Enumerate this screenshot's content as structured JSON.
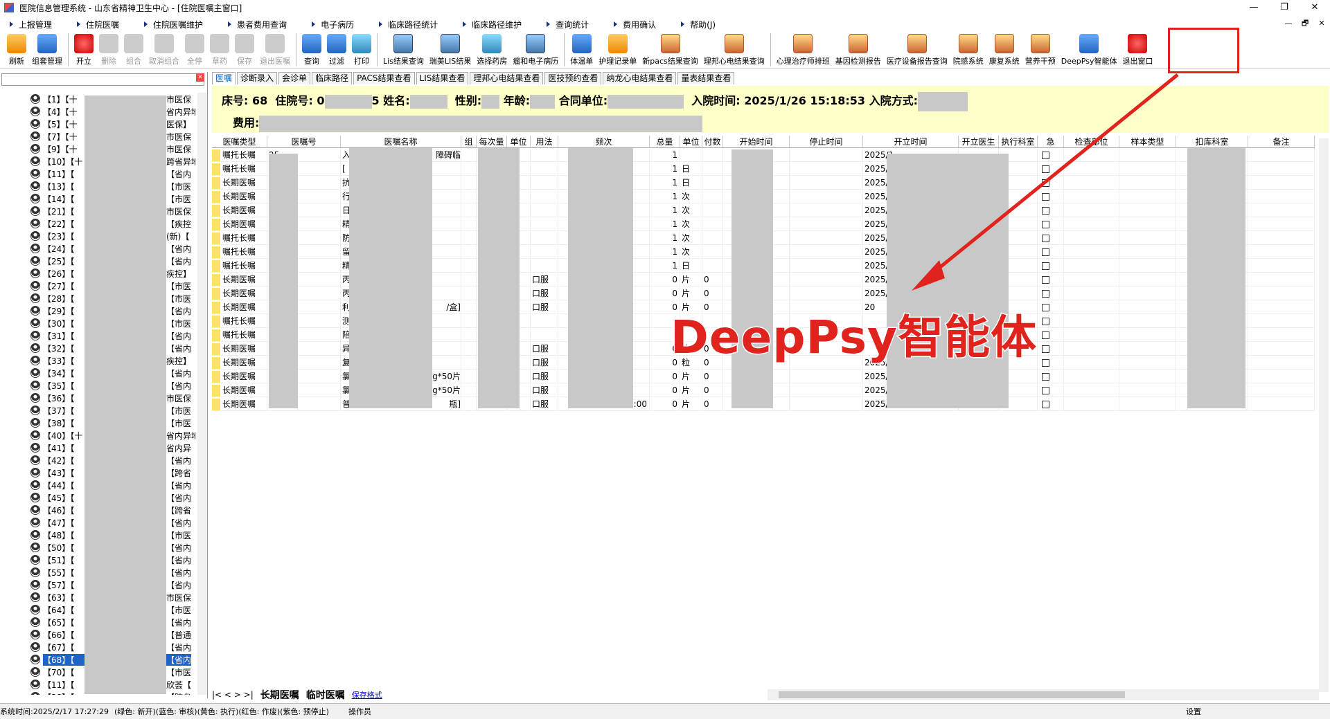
{
  "window": {
    "title": "医院信息管理系统 - 山东省精神卫生中心 - [住院医嘱主窗口]",
    "controls": [
      "—",
      "❐",
      "✕"
    ]
  },
  "menu": {
    "items": [
      "上报管理",
      "住院医嘱",
      "住院医嘱维护",
      "患者费用查询",
      "电子病历",
      "临床路径统计",
      "临床路径维护",
      "查询统计",
      "费用确认",
      "帮助(J)"
    ],
    "right_controls": [
      "—",
      "🗗",
      "✕"
    ]
  },
  "toolbar": {
    "buttons": [
      {
        "label": "刷新",
        "icon": "refresh-icon"
      },
      {
        "label": "组套管理",
        "icon": "cubes-icon"
      },
      {
        "label": "开立",
        "icon": "new-order-icon"
      },
      {
        "label": "删除",
        "icon": "delete-icon"
      },
      {
        "label": "组合",
        "icon": "combine-icon"
      },
      {
        "label": "取消组合",
        "icon": "cancel-combine-icon"
      },
      {
        "label": "全停",
        "icon": "stop-all-icon"
      },
      {
        "label": "草药",
        "icon": "herb-icon"
      },
      {
        "label": "保存",
        "icon": "save-icon"
      },
      {
        "label": "退出医嘱",
        "icon": "exit-order-icon"
      },
      {
        "label": "查询",
        "icon": "search-icon"
      },
      {
        "label": "过滤",
        "icon": "filter-icon"
      },
      {
        "label": "打印",
        "icon": "print-icon"
      },
      {
        "label": "Lis结果查询",
        "icon": "lis-icon"
      },
      {
        "label": "瑞美LIS结果",
        "icon": "lis-icon"
      },
      {
        "label": "选择药房",
        "icon": "pharmacy-icon"
      },
      {
        "label": "瘤和电子病历",
        "icon": "emr-icon"
      },
      {
        "label": "体温单",
        "icon": "thermometer-icon"
      },
      {
        "label": "护理记录单",
        "icon": "nurse-icon"
      },
      {
        "label": "新pacs结果查询",
        "icon": "pacs-icon"
      },
      {
        "label": "理邦心电结果查询",
        "icon": "ecg-icon"
      },
      {
        "label": "心理治疗师排班",
        "icon": "schedule-icon"
      },
      {
        "label": "基因检测报告",
        "icon": "gene-icon"
      },
      {
        "label": "医疗设备报告查询",
        "icon": "device-icon"
      },
      {
        "label": "院感系统",
        "icon": "infection-icon"
      },
      {
        "label": "康复系统",
        "icon": "rehab-icon"
      },
      {
        "label": "营养干预",
        "icon": "nutrition-icon"
      },
      {
        "label": "DeepPsy智能体",
        "icon": "deeppsy-icon"
      },
      {
        "label": "退出窗口",
        "icon": "power-icon"
      }
    ]
  },
  "patient_tree": {
    "rows": [
      {
        "bed": "【1】【十",
        "ins": "市医保"
      },
      {
        "bed": "【4】【十",
        "ins": "省内异地"
      },
      {
        "bed": "【5】【十",
        "ins": "医保】"
      },
      {
        "bed": "【7】【十",
        "ins": "市医保"
      },
      {
        "bed": "【9】【十",
        "ins": "市医保"
      },
      {
        "bed": "【10】【十",
        "ins": "跨省异地"
      },
      {
        "bed": "【11】【",
        "ins": "【省内"
      },
      {
        "bed": "【13】【",
        "ins": "【市医"
      },
      {
        "bed": "【14】【",
        "ins": "【市医"
      },
      {
        "bed": "【21】【",
        "ins": "市医保"
      },
      {
        "bed": "【22】【",
        "ins": "【疾控"
      },
      {
        "bed": "【23】【",
        "ins": "(新)【"
      },
      {
        "bed": "【24】【",
        "ins": "【省内"
      },
      {
        "bed": "【25】【",
        "ins": "【省内"
      },
      {
        "bed": "【26】【",
        "ins": "疾控】"
      },
      {
        "bed": "【27】【",
        "ins": "【市医"
      },
      {
        "bed": "【28】【",
        "ins": "【市医"
      },
      {
        "bed": "【29】【",
        "ins": "【省内"
      },
      {
        "bed": "【30】【",
        "ins": "【市医"
      },
      {
        "bed": "【31】【",
        "ins": "【省内"
      },
      {
        "bed": "【32】【",
        "ins": "【省内"
      },
      {
        "bed": "【33】【",
        "ins": "疾控】"
      },
      {
        "bed": "【34】【",
        "ins": "【省内"
      },
      {
        "bed": "【35】【",
        "ins": "【省内"
      },
      {
        "bed": "【36】【",
        "ins": "市医保"
      },
      {
        "bed": "【37】【",
        "ins": "【市医"
      },
      {
        "bed": "【38】【",
        "ins": "【市医"
      },
      {
        "bed": "【40】【十",
        "ins": "省内异地"
      },
      {
        "bed": "【41】【",
        "ins": "省内异"
      },
      {
        "bed": "【42】【",
        "ins": "【省内"
      },
      {
        "bed": "【43】【",
        "ins": "【跨省"
      },
      {
        "bed": "【44】【",
        "ins": "【省内"
      },
      {
        "bed": "【45】【",
        "ins": "【省内"
      },
      {
        "bed": "【46】【",
        "ins": "【跨省"
      },
      {
        "bed": "【47】【",
        "ins": "【省内"
      },
      {
        "bed": "【48】【",
        "ins": "【市医"
      },
      {
        "bed": "【50】【",
        "ins": "【省内"
      },
      {
        "bed": "【51】【",
        "ins": "【省内"
      },
      {
        "bed": "【55】【",
        "ins": "【省内"
      },
      {
        "bed": "【57】【",
        "ins": "【省内"
      },
      {
        "bed": "【63】【",
        "ins": "市医保"
      },
      {
        "bed": "【64】【",
        "ins": "【市医"
      },
      {
        "bed": "【65】【",
        "ins": "【省内"
      },
      {
        "bed": "【66】【",
        "ins": "【普通"
      },
      {
        "bed": "【67】【",
        "ins": "【省内"
      },
      {
        "bed": "【68】【",
        "ins": "【省内",
        "selected": true
      },
      {
        "bed": "【70】【",
        "ins": "【市医"
      },
      {
        "bed": "【11】【",
        "ins": "欣荟【"
      },
      {
        "bed": "【38】【",
        "ins": "【跨省"
      }
    ]
  },
  "tabs": [
    "医嘱",
    "诊断录入",
    "会诊单",
    "临床路径",
    "PACS结果查看",
    "LIS结果查看",
    "理邦心电结果查看",
    "医技预约查看",
    "纳龙心电结果查看",
    "量表结果查看"
  ],
  "patient_info": {
    "bed_label": "床号:",
    "bed_value": "68",
    "admission_no_label": "住院号:",
    "admission_no_prefix": "0",
    "admission_no_suffix": "5",
    "name_label": "姓名:",
    "gender_label": "性别:",
    "age_label": "年龄:",
    "unit_label": "合同单位:",
    "admit_time_label": "入院时间:",
    "admit_time_value": "2025/1/26 15:18:53",
    "admit_method_label": "入院方式:",
    "fee_label": "费用:"
  },
  "grid": {
    "headers": [
      "医嘱类型",
      "医嘱号",
      "医嘱名称",
      "组",
      "每次量",
      "单位",
      "用法",
      "频次",
      "总量",
      "单位",
      "付数",
      "开始时间",
      "停止时间",
      "开立时间",
      "开立医生",
      "执行科室",
      "急",
      "检查部位",
      "样本类型",
      "扣库科室",
      "备注"
    ],
    "rows": [
      {
        "type": "嘱托长嘱",
        "no": "25",
        "name": "入",
        "name_tail": "障碍临",
        "qty": "",
        "unit": "",
        "usage": "",
        "freq_tail": "",
        "total": "1",
        "tunit": "",
        "pay": "",
        "open": "2025/1"
      },
      {
        "type": "嘱托长嘱",
        "no": "25",
        "name": "[",
        "name_tail": "",
        "qty": "",
        "unit": "",
        "usage": "",
        "freq_tail": "",
        "total": "1",
        "tunit": "日",
        "pay": "",
        "open": "2025/1"
      },
      {
        "type": "长期医嘱",
        "no": "25",
        "name": "抗",
        "name_tail": "",
        "qty": "",
        "unit": "",
        "usage": "",
        "freq_tail": "",
        "total": "1",
        "tunit": "日",
        "pay": "",
        "open": "2025/1"
      },
      {
        "type": "长期医嘱",
        "no": "25",
        "name": "行",
        "name_tail": "",
        "qty": "",
        "unit": "",
        "usage": "",
        "freq_tail": "",
        "total": "1",
        "tunit": "次",
        "pay": "",
        "open": "2025/1"
      },
      {
        "type": "长期医嘱",
        "no": "25",
        "name": "日",
        "name_tail": "",
        "qty": "",
        "unit": "",
        "usage": "",
        "freq_tail": "",
        "total": "1",
        "tunit": "次",
        "pay": "",
        "open": "2025/1"
      },
      {
        "type": "长期医嘱",
        "no": "25",
        "name": "精",
        "name_tail": "",
        "qty": "",
        "unit": "",
        "usage": "",
        "freq_tail": "",
        "total": "1",
        "tunit": "次",
        "pay": "",
        "open": "2025/1"
      },
      {
        "type": "嘱托长嘱",
        "no": "25",
        "name": "防",
        "name_tail": "",
        "qty": "",
        "unit": "",
        "usage": "",
        "freq_tail": "",
        "total": "1",
        "tunit": "次",
        "pay": "",
        "open": "2025/1"
      },
      {
        "type": "嘱托长嘱",
        "no": "25",
        "name": "留",
        "name_tail": "",
        "qty": "",
        "unit": "",
        "usage": "",
        "freq_tail": "",
        "total": "1",
        "tunit": "次",
        "pay": "",
        "open": "2025/1"
      },
      {
        "type": "嘱托长嘱",
        "no": "25",
        "name": "精",
        "name_tail": "",
        "qty": "",
        "unit": "",
        "usage": "",
        "freq_tail": "",
        "total": "1",
        "tunit": "日",
        "pay": "",
        "open": "2025/1"
      },
      {
        "type": "长期医嘱",
        "no": "25",
        "name": "丙",
        "name_tail": "",
        "qty": "",
        "unit": "",
        "usage": "口服",
        "freq_tail": "",
        "total": "0",
        "tunit": "片",
        "pay": "0",
        "open": "2025/1"
      },
      {
        "type": "长期医嘱",
        "no": "25",
        "name": "丙",
        "name_tail": "",
        "qty": "",
        "unit": "",
        "usage": "口服",
        "freq_tail": "",
        "total": "0",
        "tunit": "片",
        "pay": "0",
        "open": "2025/1"
      },
      {
        "type": "长期医嘱",
        "no": "25",
        "name": "利",
        "name_tail": "/盒]",
        "qty": "",
        "unit": "",
        "usage": "口服",
        "freq_tail": "",
        "total": "0",
        "tunit": "片",
        "pay": "0",
        "open": "20"
      },
      {
        "type": "嘱托长嘱",
        "no": "25",
        "name": "测",
        "name_tail": "",
        "qty": "",
        "unit": "",
        "usage": "",
        "freq_tail": "",
        "total": "",
        "tunit": "",
        "pay": "",
        "open": ""
      },
      {
        "type": "嘱托长嘱",
        "no": "25",
        "name": "陪",
        "name_tail": "",
        "qty": "",
        "unit": "",
        "usage": "",
        "freq_tail": "",
        "total": "",
        "tunit": "",
        "pay": "",
        "open": ""
      },
      {
        "type": "长期医嘱",
        "no": "26",
        "name": "异",
        "name_tail": "",
        "qty": "",
        "unit": "",
        "usage": "口服",
        "freq_tail": "",
        "total": "0",
        "tunit": "片",
        "pay": "0",
        "open": ""
      },
      {
        "type": "长期医嘱",
        "no": "26",
        "name": "复",
        "name_tail": "",
        "qty": "",
        "unit": "",
        "usage": "口服",
        "freq_tail": "",
        "total": "0",
        "tunit": "粒",
        "pay": "0",
        "open": "2025/2"
      },
      {
        "type": "长期医嘱",
        "no": "26",
        "name": "氯",
        "name_tail": "mg*50片",
        "qty": "",
        "unit": "",
        "usage": "口服",
        "freq_tail": "",
        "total": "0",
        "tunit": "片",
        "pay": "0",
        "open": "2025/2"
      },
      {
        "type": "长期医嘱",
        "no": "26",
        "name": "氯",
        "name_tail": "mg*50片",
        "qty": "",
        "unit": "",
        "usage": "口服",
        "freq_tail": "",
        "total": "0",
        "tunit": "片",
        "pay": "0",
        "open": "2025/2"
      },
      {
        "type": "长期医嘱",
        "no": "26",
        "name": "普",
        "name_tail": "瓶]",
        "qty": "",
        "unit": "",
        "usage": "口服",
        "freq_tail": "20:00",
        "total": "0",
        "tunit": "片",
        "pay": "0",
        "open": "2025/2"
      }
    ]
  },
  "annotation": {
    "label": "DeepPsy智能体",
    "color": "#e0231c"
  },
  "bottom": {
    "nav": "|< < > >|",
    "tab_long": "长期医嘱",
    "tab_temp": "临时医嘱",
    "save_format": "保存格式"
  },
  "status": {
    "system_time": "系统时间:2025/2/17 17:27:29",
    "legend": "(绿色: 新开)(蓝色: 审核)(黄色: 执行)(红色: 作废)(紫色: 预停止)",
    "operator": "操作员",
    "settings": "设置"
  },
  "colors": {
    "selected_row": "#1e64c8",
    "info_bg": "#ffffc8",
    "highlight_box": "#e0231c"
  }
}
